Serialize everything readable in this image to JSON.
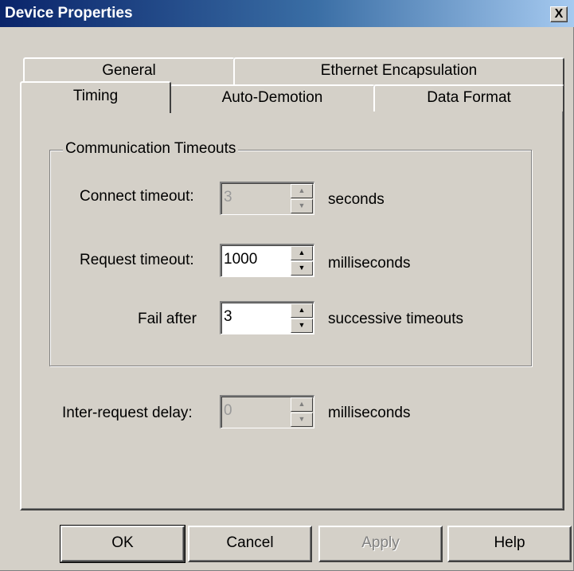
{
  "window": {
    "title": "Device Properties",
    "close_glyph": "X"
  },
  "tabs": {
    "row1": [
      {
        "label": "General"
      },
      {
        "label": "Ethernet Encapsulation"
      }
    ],
    "row2": [
      {
        "label": "Timing",
        "selected": true
      },
      {
        "label": "Auto-Demotion"
      },
      {
        "label": "Data Format"
      }
    ]
  },
  "timing": {
    "group_title": "Communication Timeouts",
    "connect_timeout": {
      "label": "Connect timeout:",
      "value": "3",
      "unit": "seconds",
      "enabled": false
    },
    "request_timeout": {
      "label": "Request timeout:",
      "value": "1000",
      "unit": "milliseconds",
      "enabled": true
    },
    "fail_after": {
      "label": "Fail after",
      "value": "3",
      "unit": "successive timeouts",
      "enabled": true
    },
    "inter_request_delay": {
      "label": "Inter-request delay:",
      "value": "0",
      "unit": "milliseconds",
      "enabled": false
    }
  },
  "buttons": {
    "ok": "OK",
    "cancel": "Cancel",
    "apply": "Apply",
    "help": "Help"
  },
  "icons": {
    "spin_up": "▲",
    "spin_down": "▼"
  }
}
